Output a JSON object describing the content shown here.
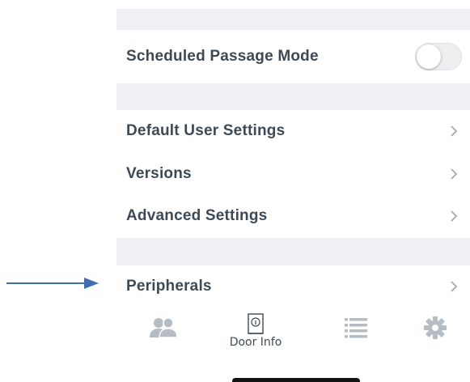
{
  "settings": {
    "scheduled_passage_mode": {
      "label": "Scheduled Passage Mode",
      "enabled": false
    },
    "default_user_settings": "Default User Settings",
    "versions": "Versions",
    "advanced_settings": "Advanced Settings",
    "peripherals": "Peripherals"
  },
  "tabbar": {
    "tabs": [
      {
        "icon": "users-icon",
        "label": ""
      },
      {
        "icon": "door-info-icon",
        "label": "Door Info"
      },
      {
        "icon": "list-icon",
        "label": ""
      },
      {
        "icon": "gear-icon",
        "label": ""
      }
    ]
  },
  "colors": {
    "section_gap": "#efeff4",
    "text": "#3d4a56",
    "tab_icon": "#b5bcc4",
    "annotation_arrow": "#3f6eb0"
  }
}
